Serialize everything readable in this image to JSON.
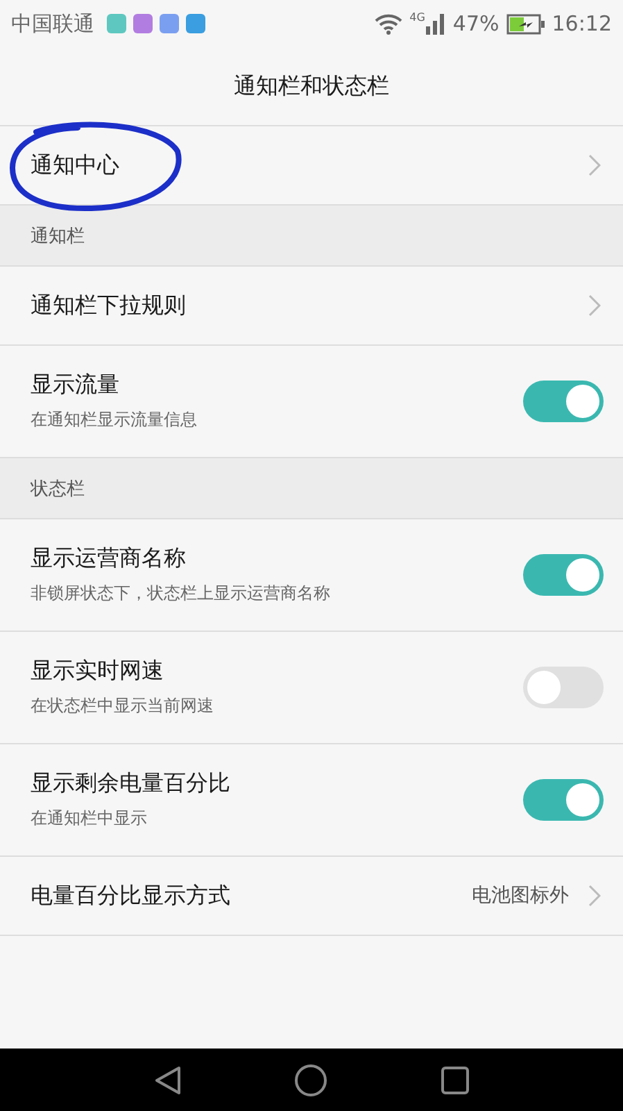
{
  "status_bar": {
    "carrier": "中国联通",
    "network": "4G",
    "battery": "47%",
    "time": "16:12"
  },
  "title": "通知栏和状态栏",
  "items": [
    {
      "kind": "link",
      "label": "通知中心",
      "circled": true
    },
    {
      "kind": "header",
      "label": "通知栏"
    },
    {
      "kind": "link",
      "label": "通知栏下拉规则"
    },
    {
      "kind": "toggle",
      "label": "显示流量",
      "sub": "在通知栏显示流量信息",
      "on": true
    },
    {
      "kind": "header",
      "label": "状态栏"
    },
    {
      "kind": "toggle",
      "label": "显示运营商名称",
      "sub": "非锁屏状态下，状态栏上显示运营商名称",
      "on": true
    },
    {
      "kind": "toggle",
      "label": "显示实时网速",
      "sub": "在状态栏中显示当前网速",
      "on": false
    },
    {
      "kind": "toggle",
      "label": "显示剩余电量百分比",
      "sub": "在通知栏中显示",
      "on": true
    },
    {
      "kind": "link",
      "label": "电量百分比显示方式",
      "value": "电池图标外"
    }
  ]
}
